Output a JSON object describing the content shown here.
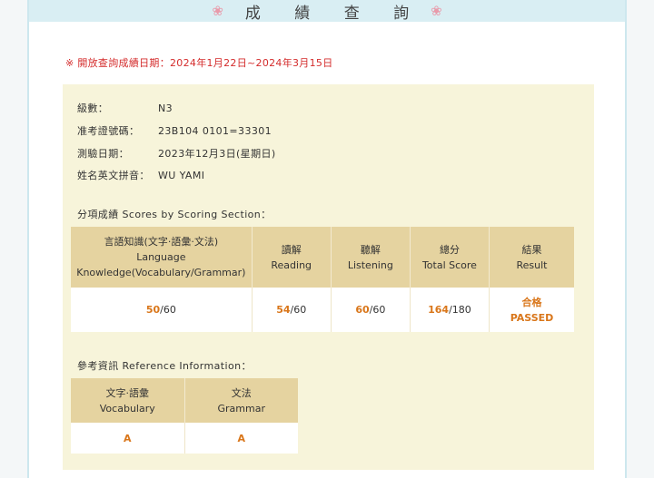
{
  "header": {
    "title": "成 績 查 詢",
    "flower_left": "❀",
    "flower_right": "❀"
  },
  "notice": "※ 開放查詢成績日期：2024年1月22日~2024年3月15日",
  "info": [
    {
      "label": "級數：",
      "value": "N3"
    },
    {
      "label": "准考證號碼：",
      "value": "23B104 0101=33301"
    },
    {
      "label": "測驗日期：",
      "value": "2023年12月3日(星期日)"
    },
    {
      "label": "姓名英文拼音：",
      "value": "WU YAMI"
    }
  ],
  "scores": {
    "title": "分項成績 Scores by Scoring Section：",
    "headers": [
      {
        "zh": "言語知識(文字·語彙·文法)",
        "en1": "Language",
        "en2": "Knowledge(Vocabulary/Grammar)"
      },
      {
        "zh": "讀解",
        "en1": "Reading"
      },
      {
        "zh": "聽解",
        "en1": "Listening"
      },
      {
        "zh": "總分",
        "en1": "Total Score"
      },
      {
        "zh": "結果",
        "en1": "Result"
      }
    ],
    "row": [
      {
        "score": "50",
        "max": "/60"
      },
      {
        "score": "54",
        "max": "/60"
      },
      {
        "score": "60",
        "max": "/60"
      },
      {
        "score": "164",
        "max": "/180"
      }
    ],
    "result_zh": "合格",
    "result_en": "PASSED"
  },
  "reference": {
    "title": "參考資訊 Reference Information：",
    "headers": [
      {
        "zh": "文字·語彙",
        "en": "Vocabulary"
      },
      {
        "zh": "文法",
        "en": "Grammar"
      }
    ],
    "values": [
      "A",
      "A"
    ]
  }
}
